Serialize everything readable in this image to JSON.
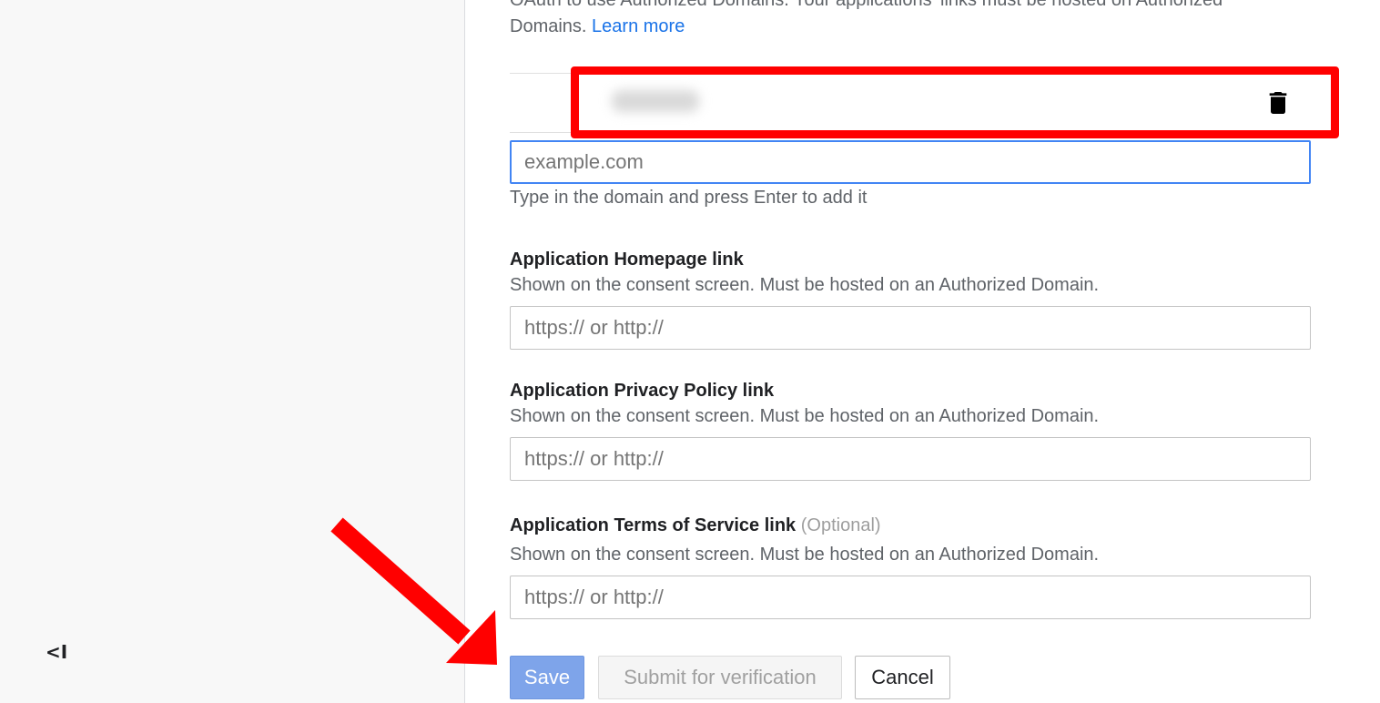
{
  "sidebar": {
    "collapse_label": "<I"
  },
  "intro": {
    "line1": "OAuth to use Authorized Domains. Your applications' links must be hosted on Authorized",
    "line2": "Domains.",
    "learn_more": "Learn more"
  },
  "authorized_domains": {
    "new_domain_placeholder": "example.com",
    "new_domain_hint": "Type in the domain and press Enter to add it"
  },
  "fields": {
    "homepage": {
      "title": "Application Homepage link",
      "description": "Shown on the consent screen. Must be hosted on an Authorized Domain.",
      "placeholder": "https:// or http://"
    },
    "privacy": {
      "title": "Application Privacy Policy link",
      "description": "Shown on the consent screen. Must be hosted on an Authorized Domain.",
      "placeholder": "https:// or http://"
    },
    "terms": {
      "title": "Application Terms of Service link",
      "optional": "(Optional)",
      "description": "Shown on the consent screen. Must be hosted on an Authorized Domain.",
      "placeholder": "https:// or http://"
    }
  },
  "actions": {
    "save": "Save",
    "submit": "Submit for verification",
    "cancel": "Cancel"
  },
  "colors": {
    "accent": "#1a73e8",
    "annotation": "#ff0000",
    "save_button": "#7ea4ea"
  }
}
